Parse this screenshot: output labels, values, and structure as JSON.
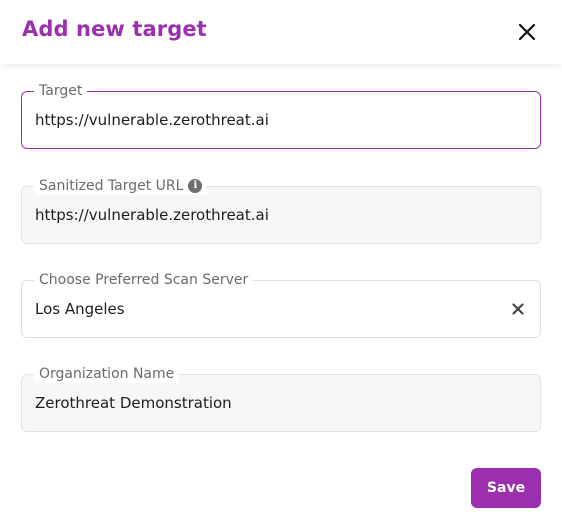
{
  "dialog": {
    "title": "Add new target",
    "close_icon": "close-icon"
  },
  "fields": {
    "target": {
      "label": "Target",
      "value": "https://vulnerable.zerothreat.ai"
    },
    "sanitized": {
      "label": "Sanitized Target URL",
      "value": "https://vulnerable.zerothreat.ai",
      "info_icon": "info-icon"
    },
    "server": {
      "label": "Choose Preferred Scan Server",
      "value": "Los Angeles",
      "clear_icon": "clear-icon"
    },
    "organization": {
      "label": "Organization Name",
      "value": "Zerothreat Demonstration"
    }
  },
  "actions": {
    "save_label": "Save"
  },
  "colors": {
    "accent": "#9b2fae",
    "field_bg": "#f7f7f7",
    "label": "#6b6b6b"
  }
}
